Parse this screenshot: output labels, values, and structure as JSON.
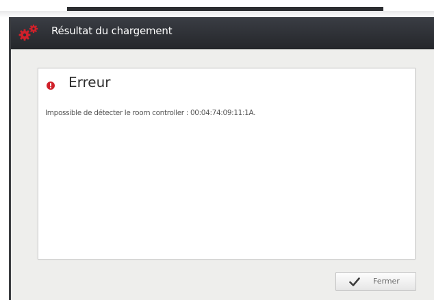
{
  "dialog": {
    "title": "Résultat du chargement",
    "title_icon": "gears-icon",
    "accent_color": "#d0202a"
  },
  "error": {
    "icon": "error-icon",
    "heading": "Erreur",
    "message": "Impossible de détecter le room controller : 00:04:74:09:11:1A."
  },
  "footer": {
    "close_label": "Fermer",
    "close_icon": "checkmark-icon"
  }
}
